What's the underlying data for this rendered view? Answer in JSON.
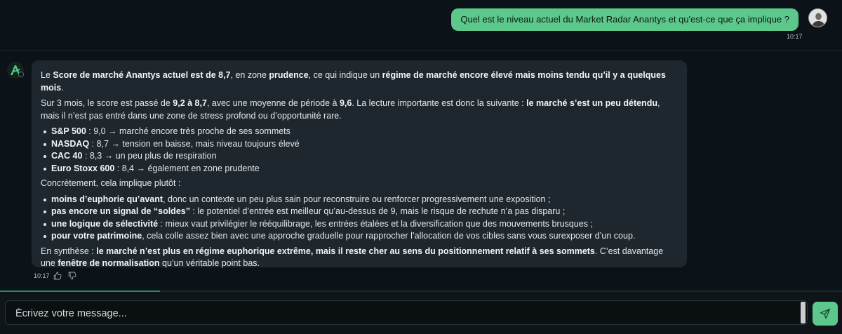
{
  "user_message": {
    "text": "Quel est le niveau actuel du Market Radar Anantys et qu'est-ce que ça implique ?",
    "time": "10:17"
  },
  "assistant_message": {
    "time": "10:17",
    "p1": {
      "t1": "Le ",
      "b1": "Score de marché Anantys actuel est de 8,7",
      "t2": ", en zone ",
      "b2": "prudence",
      "t3": ", ce qui indique un ",
      "b3": "régime de marché encore élevé mais moins tendu qu’il y a quelques mois",
      "t4": "."
    },
    "p2": {
      "t1": "Sur 3 mois, le score est passé de ",
      "b1": "9,2 à 8,7",
      "t2": ", avec une moyenne de période à ",
      "b2": "9,6",
      "t3": ". La lecture importante est donc la suivante : ",
      "b3": "le marché s’est un peu détendu",
      "t4": ", mais il n’est pas entré dans une zone de stress profond ou d’opportunité rare."
    },
    "indices": [
      {
        "name": "S&P 500",
        "text": " : 9,0 → marché encore très proche de ses sommets"
      },
      {
        "name": "NASDAQ",
        "text": " : 8,7 → tension en baisse, mais niveau toujours élevé"
      },
      {
        "name": "CAC 40",
        "text": " : 8,3 → un peu plus de respiration"
      },
      {
        "name": "Euro Stoxx 600",
        "text": " : 8,4 → également en zone prudente"
      }
    ],
    "p3": "Concrètement, cela implique plutôt :",
    "implications": [
      {
        "bold": "moins d’euphorie qu’avant",
        "text": ", donc un contexte un peu plus sain pour reconstruire ou renforcer progressivement une exposition ;"
      },
      {
        "bold": "pas encore un signal de “soldes”",
        "text": " : le potentiel d’entrée est meilleur qu’au-dessus de 9, mais le risque de rechute n’a pas disparu ;"
      },
      {
        "bold": "une logique de sélectivité",
        "text": " : mieux vaut privilégier le rééquilibrage, les entrées étalées et la diversification que des mouvements brusques ;"
      },
      {
        "bold": "pour votre patrimoine",
        "text": ", cela colle assez bien avec une approche graduelle pour rapprocher l’allocation de vos cibles sans vous surexposer d’un coup."
      }
    ],
    "p4": {
      "t1": "En synthèse : ",
      "b1": "le marché n’est plus en régime euphorique extrême, mais il reste cher au sens du positionnement relatif à ses sommets",
      "t2": ". C’est davantage une ",
      "b2": "fenêtre de normalisation",
      "t3": " qu’un véritable point bas."
    }
  },
  "icons": {
    "bot_avatar": "anantys-logo-icon",
    "like": "thumbs-up-icon",
    "dislike": "thumbs-down-icon",
    "send": "send-icon"
  },
  "composer": {
    "placeholder": "Écrivez votre message...",
    "value": ""
  },
  "progress": {
    "fraction": 0.19
  },
  "colors": {
    "background": "#0c1318",
    "accent": "#5cc88c",
    "bubble": "#1e272d"
  }
}
